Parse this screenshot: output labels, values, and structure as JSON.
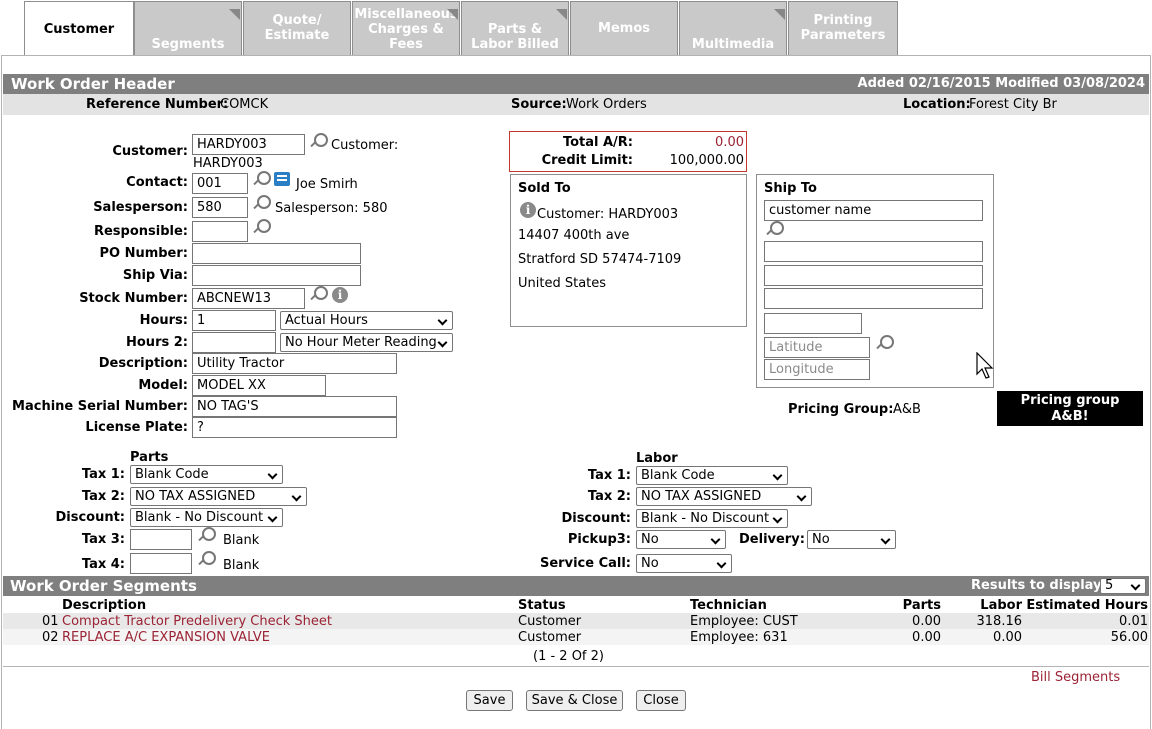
{
  "tabs": [
    {
      "label": "Customer"
    },
    {
      "label": "Segments"
    },
    {
      "label": "Quote/ Estimate"
    },
    {
      "label": "Miscellaneous Charges & Fees"
    },
    {
      "label": "Parts & Labor Billed"
    },
    {
      "label": "Memos"
    },
    {
      "label": "Multimedia"
    },
    {
      "label": "Printing Parameters"
    }
  ],
  "header": {
    "title": "Work Order Header",
    "added_modified": "Added 02/16/2015 Modified 03/08/2024"
  },
  "ref": {
    "reference_label": "Reference Number:",
    "reference_value": "COMCK",
    "source_label": "Source:",
    "source_value": "Work Orders",
    "location_label": "Location:",
    "location_value": "Forest City Br"
  },
  "form": {
    "customer_label": "Customer:",
    "customer_value": "HARDY003",
    "customer_name_label": "Customer:",
    "customer_name_value": "HARDY003",
    "contact_label": "Contact:",
    "contact_value": "001",
    "contact_name": "Joe Smirh",
    "salesperson_label": "Salesperson:",
    "salesperson_value": "580",
    "salesperson_text": "Salesperson: 580",
    "responsible_label": "Responsible:",
    "responsible_value": "",
    "po_label": "PO Number:",
    "po_value": "",
    "shipvia_label": "Ship Via:",
    "shipvia_value": "",
    "stock_label": "Stock Number:",
    "stock_value": "ABCNEW13",
    "hours_label": "Hours:",
    "hours_value": "1",
    "hours_type": "Actual Hours",
    "hours2_label": "Hours 2:",
    "hours2_value": "",
    "hours2_type": "No Hour Meter Reading",
    "description_label": "Description:",
    "description_value": "Utility Tractor",
    "model_label": "Model:",
    "model_value": "MODEL XX",
    "serial_label": "Machine Serial Number:",
    "serial_value": "NO TAG'S",
    "plate_label": "License Plate:",
    "plate_value": "?"
  },
  "ar": {
    "total_label": "Total A/R:",
    "total_value": "0.00",
    "credit_label": "Credit Limit:",
    "credit_value": "100,000.00"
  },
  "sold_to": {
    "title": "Sold To",
    "customer": "Customer: HARDY003",
    "line1": "14407 400th ave",
    "line2": "Stratford SD 57474-7109",
    "line3": "United States"
  },
  "ship_to": {
    "title": "Ship To",
    "name_value": "customer name",
    "latitude_placeholder": "Latitude",
    "longitude_placeholder": "Longitude"
  },
  "pricing": {
    "label": "Pricing Group:",
    "value": "A&B",
    "badge": "Pricing group A&B!"
  },
  "parts": {
    "title": "Parts",
    "tax1_label": "Tax 1:",
    "tax1_value": "Blank Code",
    "tax2_label": "Tax 2:",
    "tax2_value": "NO TAX ASSIGNED",
    "discount_label": "Discount:",
    "discount_value": "Blank - No Discount",
    "tax3_label": "Tax 3:",
    "tax3_text": "Blank",
    "tax4_label": "Tax 4:",
    "tax4_text": "Blank"
  },
  "labor": {
    "title": "Labor",
    "tax1_label": "Tax 1:",
    "tax1_value": "Blank Code",
    "tax2_label": "Tax 2:",
    "tax2_value": "NO TAX ASSIGNED",
    "discount_label": "Discount:",
    "discount_value": "Blank - No Discount",
    "pickup_label": "Pickup3:",
    "pickup_value": "No",
    "delivery_label": "Delivery:",
    "delivery_value": "No",
    "service_label": "Service Call:",
    "service_value": "No"
  },
  "segments": {
    "title": "Work Order Segments",
    "results_label": "Results to display:",
    "results_value": "5",
    "columns": [
      "Description",
      "Status",
      "Technician",
      "Parts",
      "Labor",
      "Estimated Hours"
    ],
    "rows": [
      {
        "num": "01",
        "desc": "Compact Tractor Predelivery Check Sheet",
        "status": "Customer",
        "tech": "Employee: CUST",
        "parts": "0.00",
        "labor": "318.16",
        "hours": "0.01"
      },
      {
        "num": "02",
        "desc": "REPLACE A/C EXPANSION VALVE",
        "status": "Customer",
        "tech": "Employee: 631",
        "parts": "0.00",
        "labor": "0.00",
        "hours": "56.00"
      }
    ],
    "pager": "(1 - 2 Of 2)",
    "bill_link": "Bill Segments"
  },
  "buttons": {
    "save": "Save",
    "save_close": "Save & Close",
    "close": "Close"
  }
}
